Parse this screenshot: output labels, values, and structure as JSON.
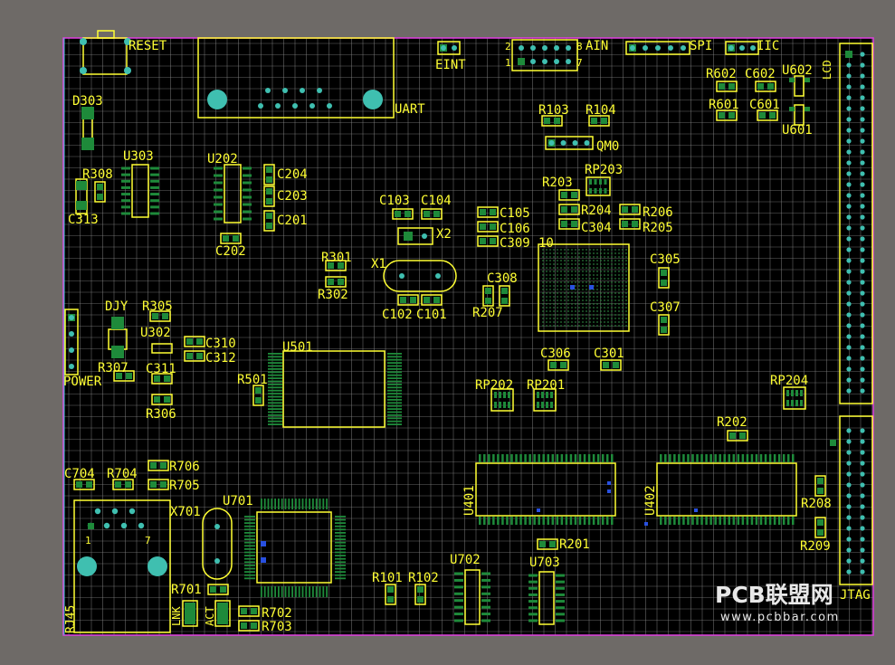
{
  "board": {
    "background_color": "#6e6a67",
    "board_color": "#000000",
    "grid_color": "#8a8a8a",
    "silkscreen_color": "#ffff33",
    "pad_color": "#1e8a3a",
    "via_color": "#3fbfb0",
    "outline_color": "#e040e0"
  },
  "labels": {
    "reset": "RESET",
    "uart": "UART",
    "eint": "EINT",
    "ain": "AIN",
    "spi": "SPI",
    "iic": "IIC",
    "j2": "2",
    "j8": "8",
    "j1": "1",
    "j7": "7",
    "d303": "D303",
    "r308": "R308",
    "c313": "C313",
    "u303": "U303",
    "u202": "U202",
    "c204": "C204",
    "c203": "C203",
    "c201": "C201",
    "c202": "C202",
    "r103": "R103",
    "r104": "R104",
    "qm0": "QM0",
    "r602": "R602",
    "c602": "C602",
    "u602": "U602",
    "r601": "R601",
    "c601": "C601",
    "u601": "U601",
    "lcd": "LCD",
    "rp203": "RP203",
    "r203": "R203",
    "r204": "R204",
    "r206": "R206",
    "c304": "C304",
    "r205": "R205",
    "c103": "C103",
    "c104": "C104",
    "x2": "X2",
    "c105": "C105",
    "c106": "C106",
    "c309": "C309",
    "u_ten": "10",
    "r301": "R301",
    "x1": "X1",
    "r302": "R302",
    "c102": "C102",
    "c101": "C101",
    "c308": "C308",
    "r207": "R207",
    "c305": "C305",
    "c307": "C307",
    "djy": "DJY",
    "r305": "R305",
    "u302": "U302",
    "c310": "C310",
    "c312": "C312",
    "u501": "U501",
    "power": "POWER",
    "r307": "R307",
    "c311": "C311",
    "r306": "R306",
    "r501": "R501",
    "c306": "C306",
    "c301": "C301",
    "rp202": "RP202",
    "rp201": "RP201",
    "rp204": "RP204",
    "r202": "R202",
    "c704": "C704",
    "r704": "R704",
    "r706": "R706",
    "r705": "R705",
    "u701": "U701",
    "x701": "X701",
    "rj_1": "1",
    "rj_7": "7",
    "u401": "U401",
    "u402": "U402",
    "r208": "R208",
    "r209": "R209",
    "r201": "R201",
    "u702": "U702",
    "u703": "U703",
    "r101": "R101",
    "r102": "R102",
    "r701": "R701",
    "lnk": "LNK",
    "act": "ACT",
    "r702": "R702",
    "r703": "R703",
    "rj45": "RJ45",
    "jtag": "JTAG"
  },
  "watermark": {
    "title": "PCB联盟网",
    "url": "www.pcbbar.com"
  }
}
